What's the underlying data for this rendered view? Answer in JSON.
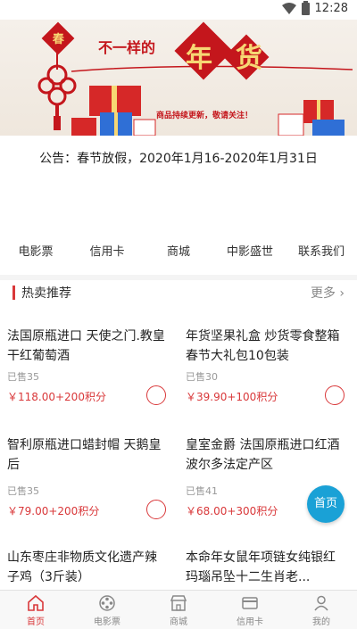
{
  "status": {
    "time": "12:28"
  },
  "banner": {
    "headline": "不一样的",
    "big_text": "年货",
    "sub": "商品持续更新，敬请关注！",
    "tag": "春"
  },
  "notice": "公告：春节放假，2020年1月16-2020年1月31日",
  "nav": [
    "电影票",
    "信用卡",
    "商城",
    "中影盛世",
    "联系我们"
  ],
  "section": {
    "title": "热卖推荐",
    "more": "更多 ›"
  },
  "products": [
    {
      "name": "法国原瓶进口 天使之门.教皇干红葡萄酒",
      "sold": "已售35",
      "price": "￥118.00+200积分"
    },
    {
      "name": "年货坚果礼盒 炒货零食整箱春节大礼包10包装",
      "sold": "已售30",
      "price": "￥39.90+100积分"
    },
    {
      "name": "智利原瓶进口蜡封帽 天鹅皇后",
      "sold": "已售35",
      "price": "￥79.00+200积分"
    },
    {
      "name": "皇室金爵 法国原瓶进口红酒 波尔多法定产区",
      "sold": "已售41",
      "price": "￥68.00+300积分"
    },
    {
      "name": "山东枣庄非物质文化遗产辣子鸡（3斤装）",
      "sold": "",
      "price": ""
    },
    {
      "name": "本命年女鼠年项链女纯银红玛瑙吊坠十二生肖老...",
      "sold": "",
      "price": ""
    }
  ],
  "float_home": "首页",
  "tabs": [
    {
      "label": "首页",
      "icon": "home-icon"
    },
    {
      "label": "电影票",
      "icon": "film-reel-icon"
    },
    {
      "label": "商城",
      "icon": "shop-icon"
    },
    {
      "label": "信用卡",
      "icon": "credit-card-icon"
    },
    {
      "label": "我的",
      "icon": "user-icon"
    }
  ],
  "colors": {
    "accent": "#d9383a",
    "float": "#1aa1d6"
  }
}
